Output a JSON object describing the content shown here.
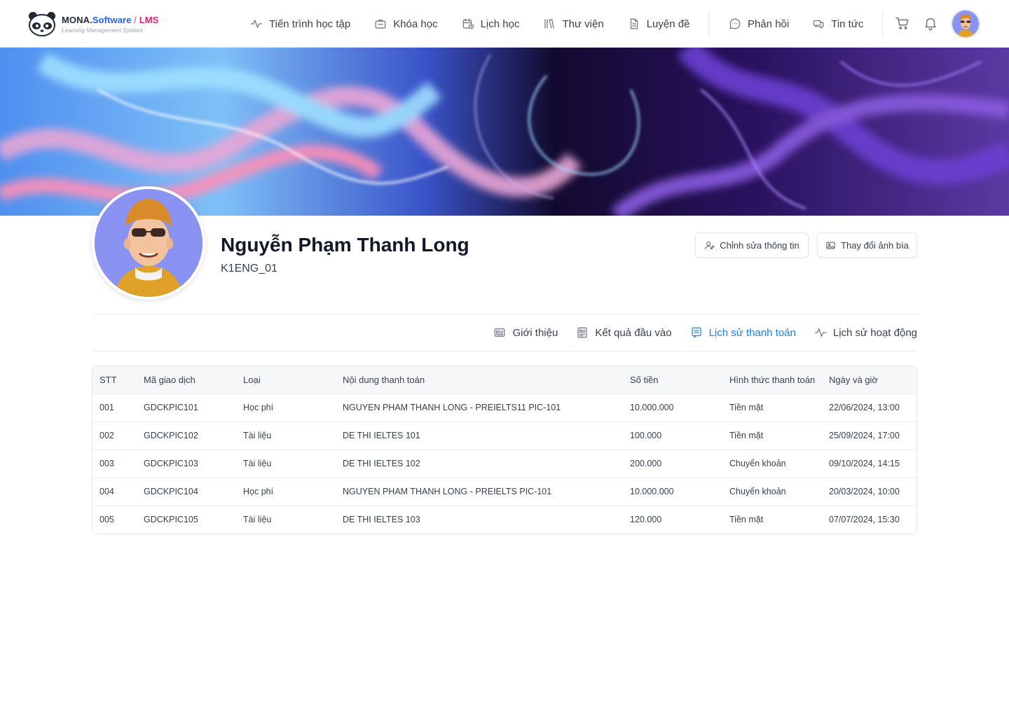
{
  "brand": {
    "name_part1": "MONA.",
    "name_part2": "Software",
    "separator": " / ",
    "name_part3": "LMS",
    "tagline": "Learning Management System"
  },
  "nav": {
    "items": [
      {
        "label": "Tiến trình học tập",
        "icon": "activity-icon"
      },
      {
        "label": "Khóa học",
        "icon": "briefcase-icon"
      },
      {
        "label": "Lịch học",
        "icon": "calendar-clock-icon"
      },
      {
        "label": "Thư viện",
        "icon": "library-icon"
      },
      {
        "label": "Luyện đề",
        "icon": "document-icon"
      },
      {
        "label": "Phản hồi",
        "icon": "chat-bubble-icon"
      },
      {
        "label": "Tin tức",
        "icon": "messages-icon"
      }
    ]
  },
  "profile": {
    "name": "Nguyễn Phạm Thanh Long",
    "code": "K1ENG_01",
    "edit_label": "Chỉnh sửa thông tin",
    "cover_label": "Thay đổi ảnh bìa"
  },
  "tabs": [
    {
      "label": "Giới thiệu",
      "icon": "id-card-icon",
      "active": false
    },
    {
      "label": "Kết quả đầu vào",
      "icon": "report-icon",
      "active": false
    },
    {
      "label": "Lịch sử thanh toán",
      "icon": "receipt-icon",
      "active": true
    },
    {
      "label": "Lịch sử hoạt động",
      "icon": "activity-icon",
      "active": false
    }
  ],
  "table": {
    "headers": [
      "STT",
      "Mã giao dịch",
      "Loại",
      "Nội dung thanh toán",
      "Số tiền",
      "Hình thức thanh toán",
      "Ngày và giờ"
    ],
    "rows": [
      [
        "001",
        "GDCKPIC101",
        "Học phí",
        "NGUYEN PHAM THANH LONG - PREIELTS11 PIC-101",
        "10.000.000",
        "Tiền mặt",
        "22/06/2024, 13:00"
      ],
      [
        "002",
        "GDCKPIC102",
        "Tài liệu",
        "DE THI IELTES 101",
        "100.000",
        "Tiền mặt",
        "25/09/2024, 17:00"
      ],
      [
        "003",
        "GDCKPIC103",
        "Tài liệu",
        "DE THI IELTES 102",
        "200.000",
        "Chuyển khoản",
        "09/10/2024, 14:15"
      ],
      [
        "004",
        "GDCKPIC104",
        "Học phí",
        "NGUYEN PHAM THANH LONG - PREIELTS PIC-101",
        "10.000.000",
        "Chuyển khoản",
        "20/03/2024, 10:00"
      ],
      [
        "005",
        "GDCKPIC105",
        "Tài liệu",
        "DE THI IELTES 103",
        "120.000",
        "Tiền mặt",
        "07/07/2024, 15:30"
      ]
    ]
  },
  "colors": {
    "accent": "#1d7fe0",
    "brand_blue": "#2563eb",
    "brand_pink": "#e11d74",
    "table_header_bg": "#f6f7f9"
  }
}
